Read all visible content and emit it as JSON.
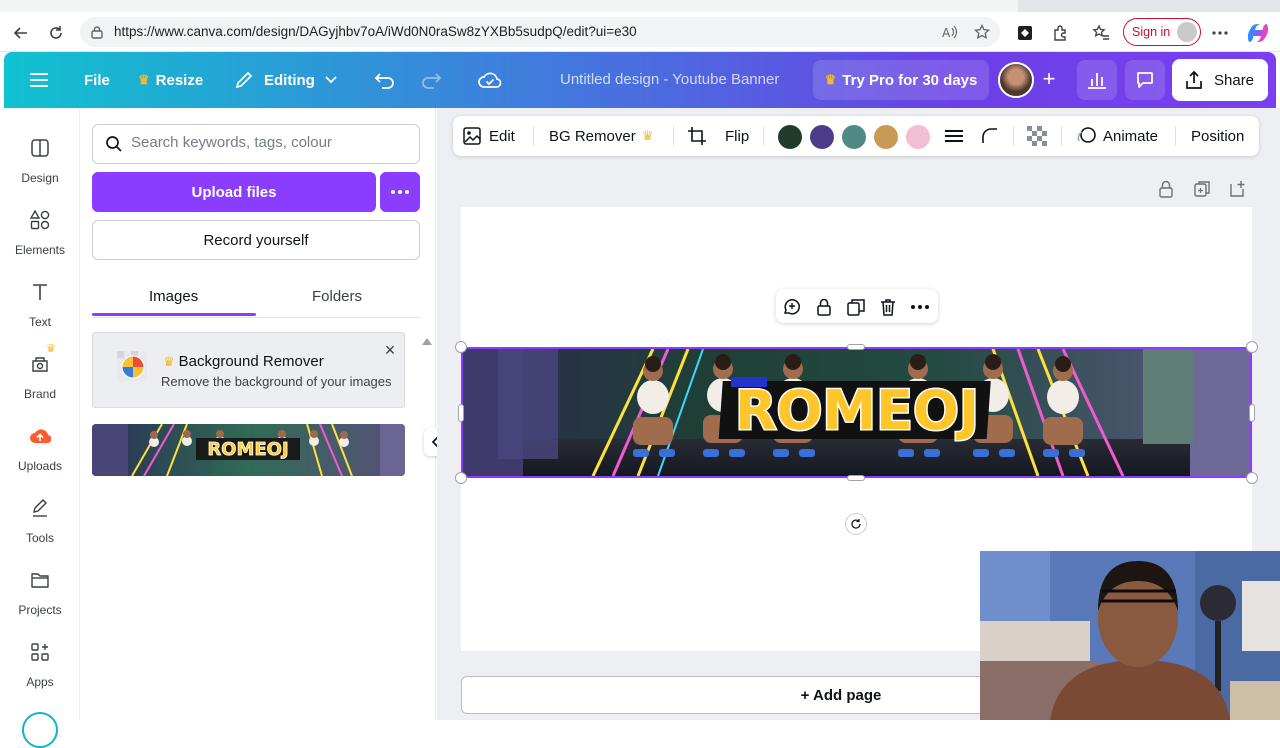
{
  "browser": {
    "url": "https://www.canva.com/design/DAGyjhbv7oA/iWd0N0raSw8zYXBb5sudpQ/edit?ui=e30",
    "signin_label": "Sign in"
  },
  "header": {
    "menu_icon": "hamburger-icon",
    "file_label": "File",
    "resize_label": "Resize",
    "editing_label": "Editing",
    "title": "Untitled design - Youtube Banner",
    "try_pro_label": "Try Pro for 30 days",
    "share_label": "Share"
  },
  "sidebar": {
    "items": [
      {
        "label": "Design",
        "icon": "design-icon"
      },
      {
        "label": "Elements",
        "icon": "elements-icon"
      },
      {
        "label": "Text",
        "icon": "text-icon"
      },
      {
        "label": "Brand",
        "icon": "brand-icon"
      },
      {
        "label": "Uploads",
        "icon": "uploads-icon"
      },
      {
        "label": "Tools",
        "icon": "tools-icon"
      },
      {
        "label": "Projects",
        "icon": "folder-icon"
      },
      {
        "label": "Apps",
        "icon": "apps-icon"
      }
    ]
  },
  "panel": {
    "search_placeholder": "Search keywords, tags, colour",
    "upload_label": "Upload files",
    "record_label": "Record yourself",
    "tabs": [
      "Images",
      "Folders"
    ],
    "active_tab": "Images",
    "promo": {
      "title": "Background Remover",
      "subtitle": "Remove the background of your images"
    },
    "thumbnail_text": "ROMEOJ"
  },
  "toolbar": {
    "edit_label": "Edit",
    "bg_remover_label": "BG Remover",
    "flip_label": "Flip",
    "animate_label": "Animate",
    "position_label": "Position",
    "swatches": [
      "#1f3d2a",
      "#4b3d8a",
      "#4f8a86",
      "#c99a55",
      "#f1bfd3"
    ]
  },
  "canvas": {
    "banner_text": "ROMEOJ",
    "add_page_label": "+ Add page"
  },
  "colors": {
    "accent": "#8b3dff",
    "pro_crown": "#f5b72b"
  }
}
